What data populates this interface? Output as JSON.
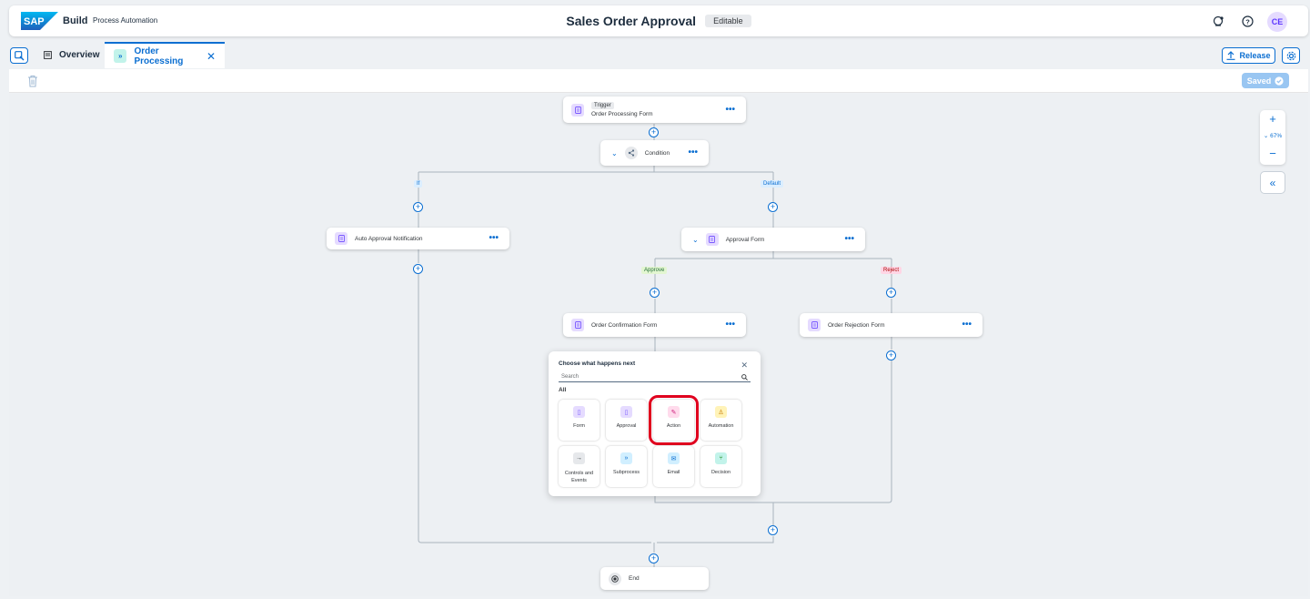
{
  "shellbar": {
    "brand": "Build",
    "product": "Process Automation",
    "title": "Sales Order Approval",
    "status": "Editable",
    "avatar_initials": "CE",
    "icons": [
      "notifications-icon",
      "help-icon"
    ]
  },
  "tabs": {
    "overview": "Overview",
    "active": "Order Processing"
  },
  "toolbar": {
    "release_label": "Release",
    "saved_label": "Saved"
  },
  "flow": {
    "trigger": {
      "tag": "Trigger",
      "label": "Order Processing Form"
    },
    "condition": {
      "label": "Condition"
    },
    "branch_if": "If",
    "branch_default": "Default",
    "auto_approval": "Auto Approval Notification",
    "approval_form": "Approval Form",
    "branch_approve": "Approve",
    "branch_reject": "Reject",
    "order_confirmation": "Order Confirmation Form",
    "order_rejection": "Order Rejection Form",
    "end": "End"
  },
  "popover": {
    "title": "Choose what happens next",
    "search_placeholder": "Search",
    "section": "All",
    "tiles": [
      {
        "label": "Form",
        "icon": "form-icon",
        "color": "#e5dbff"
      },
      {
        "label": "Approval",
        "icon": "approval-icon",
        "color": "#e5dbff"
      },
      {
        "label": "Action",
        "icon": "action-icon",
        "color": "#ffdbec",
        "selected": true
      },
      {
        "label": "Automation",
        "icon": "automation-icon",
        "color": "#fff3b8"
      },
      {
        "label": "Controls and Events",
        "icon": "controls-icon",
        "color": "#e6e8eb"
      },
      {
        "label": "Subprocess",
        "icon": "subprocess-icon",
        "color": "#d1efff"
      },
      {
        "label": "Email",
        "icon": "email-icon",
        "color": "#d1efff"
      },
      {
        "label": "Decision",
        "icon": "decision-icon",
        "color": "#c2f3ea"
      }
    ]
  },
  "zoom": {
    "level": "67%"
  },
  "colors": {
    "accent": "#0a6ed1",
    "selection": "#e0001e"
  }
}
